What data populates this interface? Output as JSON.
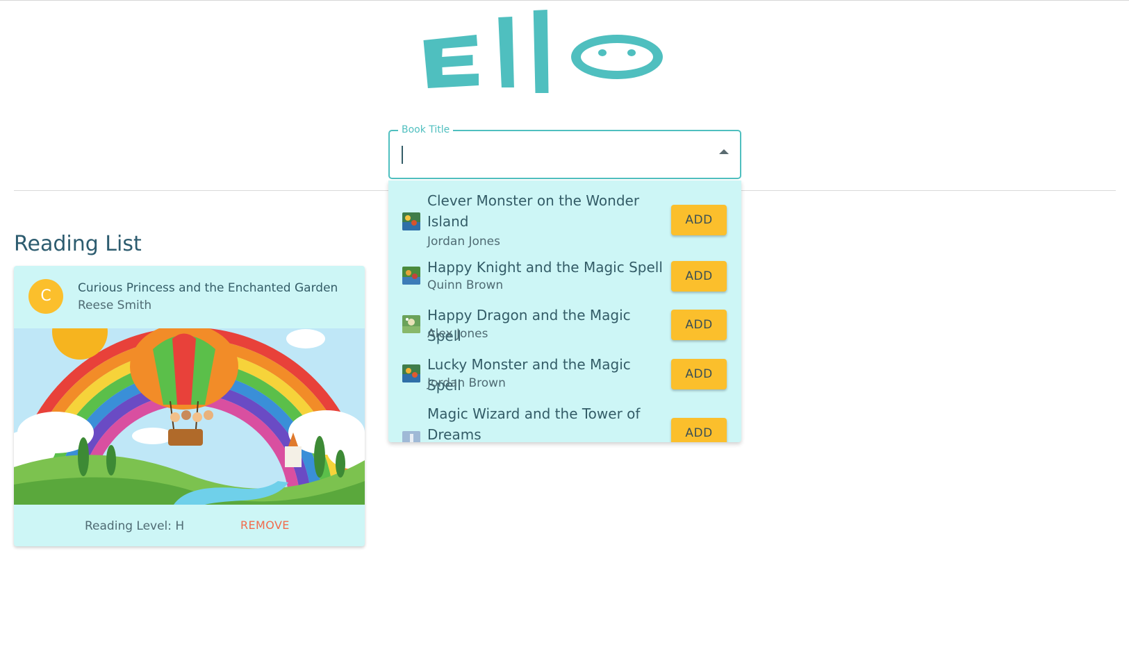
{
  "app": {
    "logo_text": "Ello",
    "brand_color": "#4fbfbf",
    "accent_color": "#fbbf2c"
  },
  "search": {
    "label": "Book Title",
    "value": "",
    "placeholder": ""
  },
  "dropdown": {
    "options": [
      {
        "title": "Clever Monster on the Wonder Island",
        "author": "Jordan Jones",
        "action": "ADD"
      },
      {
        "title": "Happy Knight and the Magic Spell",
        "author": "Quinn Brown",
        "action": "ADD"
      },
      {
        "title": "Happy Dragon and the Magic Spell",
        "author": "Alex Jones",
        "action": "ADD"
      },
      {
        "title": "Lucky Monster and the Magic Spell",
        "author": "Jordan Brown",
        "action": "ADD"
      },
      {
        "title": "Magic Wizard and the Tower of Dreams",
        "author": "",
        "action": "ADD"
      }
    ]
  },
  "reading_list": {
    "heading": "Reading List",
    "cards": [
      {
        "avatar_letter": "C",
        "title": "Curious Princess and the Enchanted Garden",
        "author": "Reese Smith",
        "level": "Reading Level: H",
        "remove_label": "REMOVE"
      }
    ]
  }
}
